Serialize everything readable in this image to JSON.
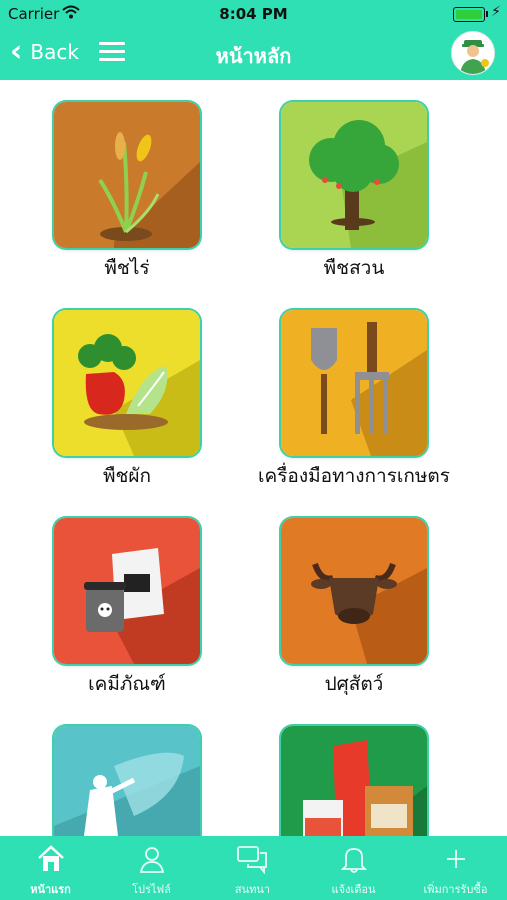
{
  "status": {
    "carrier": "Carrier",
    "time": "8:04 PM"
  },
  "nav": {
    "back_label": "Back",
    "title": "หน้าหลัก"
  },
  "categories": [
    {
      "label": "พืชไร่"
    },
    {
      "label": "พืชสวน"
    },
    {
      "label": "พืชผัก"
    },
    {
      "label": "เครื่องมือทางการเกษตร"
    },
    {
      "label": "เคมีภัณฑ์"
    },
    {
      "label": "ปศุสัตว์"
    }
  ],
  "tabs": [
    {
      "label": "หน้าแรก",
      "icon": "home-icon"
    },
    {
      "label": "โปรไฟล์",
      "icon": "profile-icon"
    },
    {
      "label": "สนทนา",
      "icon": "chat-icon"
    },
    {
      "label": "แจ้งเตือน",
      "icon": "bell-icon"
    },
    {
      "label": "เพิ่มการรับซื้อ",
      "icon": "plus-icon"
    }
  ],
  "colors": {
    "accent": "#2ee0b4",
    "tile_border": "#3ed0a8"
  }
}
